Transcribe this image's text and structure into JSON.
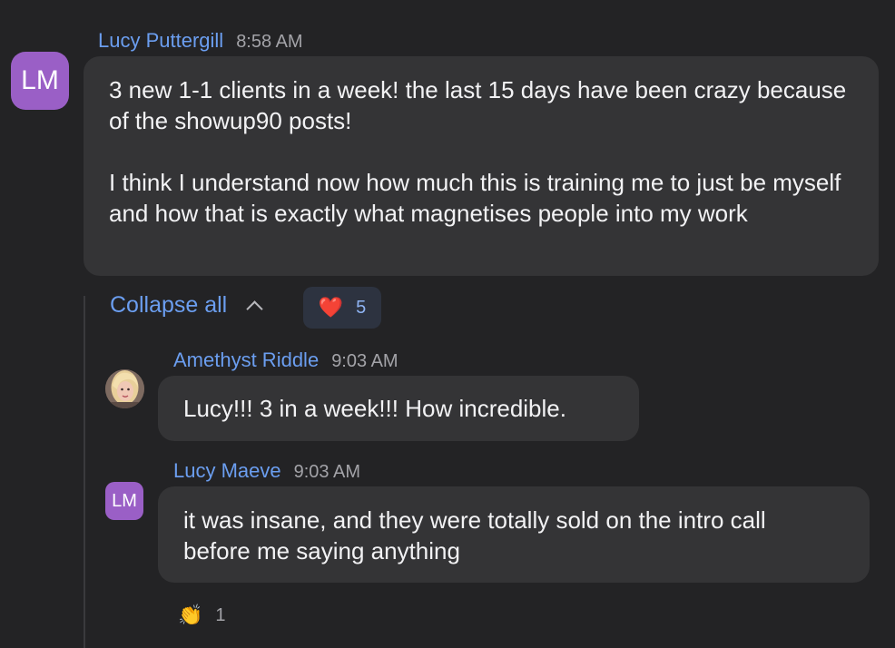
{
  "messages": [
    {
      "author": "Lucy Puttergill",
      "time": "8:58 AM",
      "avatar_initials": "LM",
      "paragraphs": [
        "3 new 1-1 clients in a week! the last 15 days have been crazy because of the showup90 posts!",
        "I think I understand now how much this is training me to just be myself and how that is exactly what magnetises people into my work"
      ]
    }
  ],
  "thread": {
    "collapse_label": "Collapse all",
    "reaction": {
      "emoji": "❤️",
      "count": "5"
    },
    "replies": [
      {
        "author": "Amethyst Riddle",
        "time": "9:03 AM",
        "text": "Lucy!!! 3 in a week!!! How incredible."
      },
      {
        "author": "Lucy Maeve",
        "time": "9:03 AM",
        "avatar_initials": "LM",
        "lines": [
          "it was insane, and they were totally sold on the intro call",
          "before me saying anything"
        ],
        "reaction": {
          "emoji": "👏",
          "count": "1"
        }
      }
    ]
  },
  "colors": {
    "background": "#232325",
    "bubble": "#343436",
    "name_link": "#6b9ef0",
    "avatar": "#9a5fc6"
  }
}
